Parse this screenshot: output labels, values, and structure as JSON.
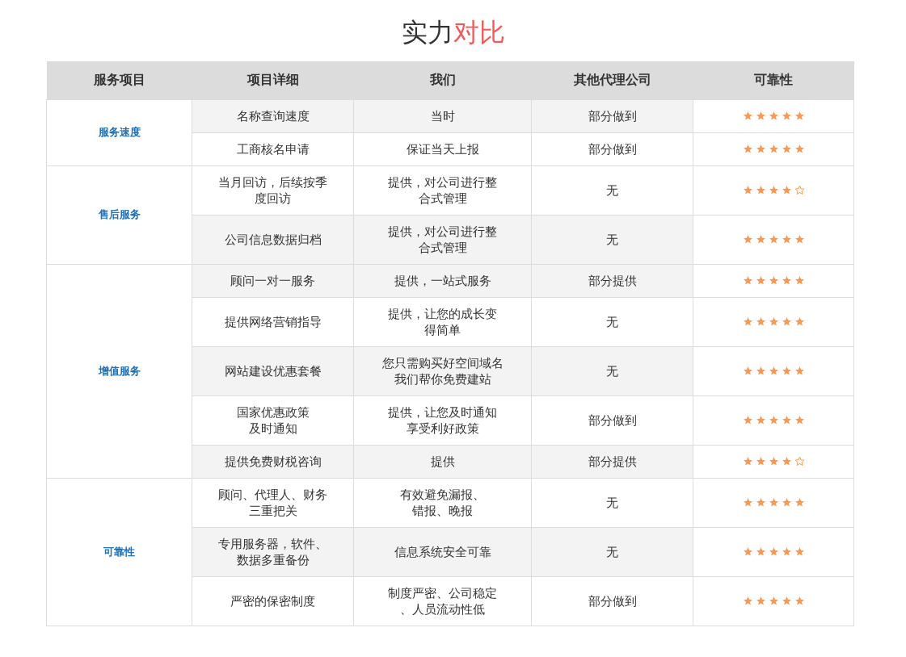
{
  "title": [
    {
      "text": "实力",
      "highlight": false
    },
    {
      "text": "对比",
      "highlight": true
    }
  ],
  "table": {
    "columns": [
      "服务项目",
      "项目详细",
      "我们",
      "其他代理公司",
      "可靠性"
    ],
    "groups": [
      {
        "category": "服务速度",
        "rows": [
          {
            "item": [
              "名称查询速度"
            ],
            "ours": [
              "当时"
            ],
            "others": "部分做到",
            "stars": 5,
            "shaded": true
          },
          {
            "item": [
              "工商核名申请"
            ],
            "ours": [
              "保证当天上报"
            ],
            "others": "部分做到",
            "stars": 5,
            "shaded": false
          }
        ]
      },
      {
        "category": "售后服务",
        "rows": [
          {
            "item": [
              "当月回访，后续按季",
              "度回访"
            ],
            "ours": [
              "提供，对公司进行整",
              "合式管理"
            ],
            "others": "无",
            "stars": 4,
            "shaded": false
          },
          {
            "item": [
              "公司信息数据归档"
            ],
            "ours": [
              "提供，对公司进行整",
              "合式管理"
            ],
            "others": "无",
            "stars": 5,
            "shaded": true
          }
        ]
      },
      {
        "category": "增值服务",
        "rows": [
          {
            "item": [
              "顾问一对一服务"
            ],
            "ours": [
              "提供，一站式服务"
            ],
            "others": "部分提供",
            "stars": 5,
            "shaded": true
          },
          {
            "item": [
              "提供网络营销指导"
            ],
            "ours": [
              "提供，让您的成长变",
              "得简单"
            ],
            "others": "无",
            "stars": 5,
            "shaded": false
          },
          {
            "item": [
              "网站建设优惠套餐"
            ],
            "ours": [
              "您只需购买好空间域名",
              "我们帮你免费建站"
            ],
            "others": "无",
            "stars": 5,
            "shaded": true
          },
          {
            "item": [
              "国家优惠政策",
              "及时通知"
            ],
            "ours": [
              "提供，让您及时通知",
              "享受利好政策"
            ],
            "others": "部分做到",
            "stars": 5,
            "shaded": false
          },
          {
            "item": [
              "提供免费财税咨询"
            ],
            "ours": [
              "提供"
            ],
            "others": "部分提供",
            "stars": 4,
            "shaded": true
          }
        ]
      },
      {
        "category": "可靠性",
        "rows": [
          {
            "item": [
              "顾问、代理人、财务",
              "三重把关"
            ],
            "ours": [
              "有效避免漏报、",
              "错报、晚报"
            ],
            "others": "无",
            "stars": 5,
            "shaded": false
          },
          {
            "item": [
              "专用服务器，软件、",
              "数据多重备份"
            ],
            "ours": [
              "信息系统安全可靠"
            ],
            "others": "无",
            "stars": 5,
            "shaded": true
          },
          {
            "item": [
              "严密的保密制度"
            ],
            "ours": [
              "制度严密、公司稳定",
              "、人员流动性低"
            ],
            "others": "部分做到",
            "stars": 5,
            "shaded": false
          }
        ]
      }
    ]
  }
}
